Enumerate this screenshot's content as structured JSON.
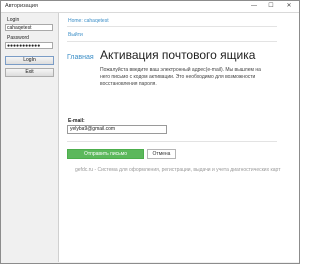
{
  "window": {
    "title": "Авторизация",
    "minimize": "—",
    "maximize": "☐",
    "close": "✕"
  },
  "left_panel": {
    "login_label": "Login",
    "login_value": "cahaqetest",
    "password_label": "Password",
    "password_value": "●●●●●●●●●●●",
    "login_button": "LogIn",
    "exit_button": "Exit"
  },
  "nav": {
    "home_link": "Home: cahaqetest",
    "logout_link": "Выйти"
  },
  "page": {
    "breadcrumb": "Главная",
    "title": "Активация почтового ящика",
    "description": "Пожалуйста введите ваш электронный адрес(e-mail). Мы вышлем на него письмо с кодом активации. Это необходимо для возможности восстановления пароля."
  },
  "form": {
    "email_label": "E-mail:",
    "email_value": "yelyba9@gmail.com",
    "send_button": "Отправить письмо",
    "cancel_button": "Отмена"
  },
  "footer": {
    "text": "gefdc.ru - Система для оформления, регистрации, выдачи и учета диагностических карт"
  }
}
